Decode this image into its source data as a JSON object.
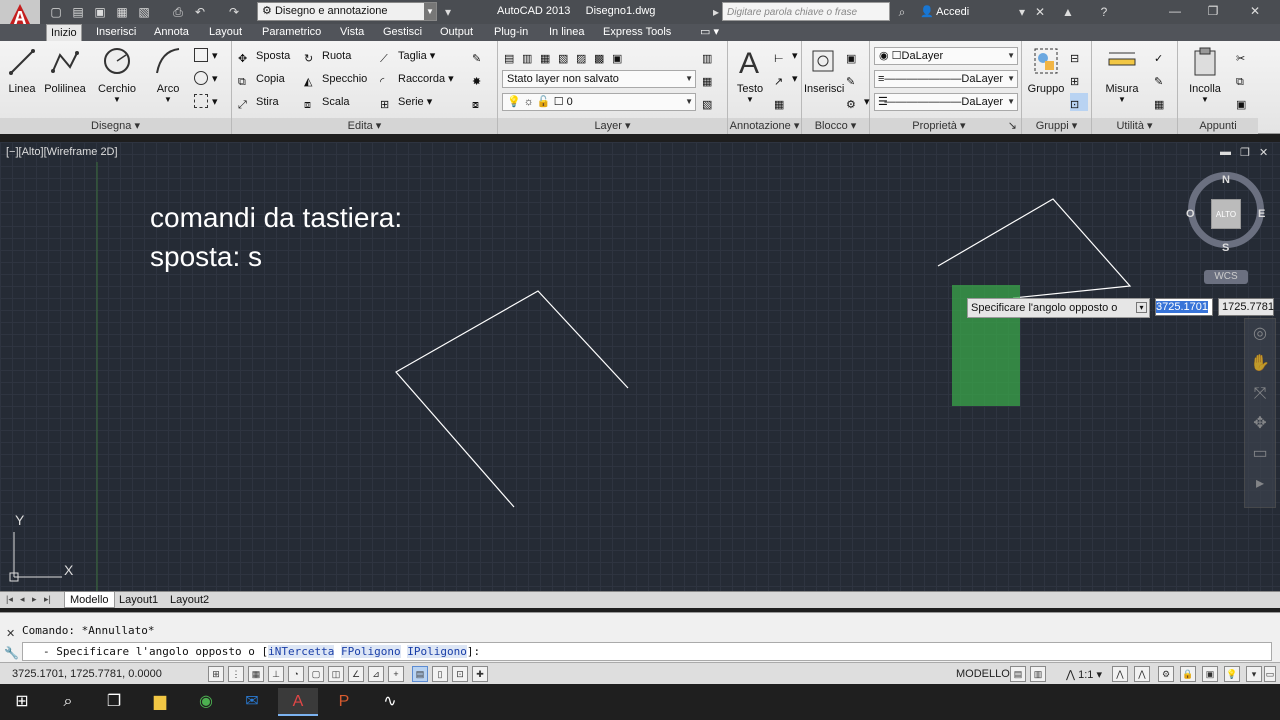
{
  "titlebar": {
    "workspace": "Disegno e annotazione",
    "app_title": "AutoCAD 2013",
    "file_name": "Disegno1.dwg",
    "search_placeholder": "Digitare parola chiave o frase",
    "signin_label": "Accedi"
  },
  "ribbon_tabs": [
    "Inizio",
    "Inserisci",
    "Annota",
    "Layout",
    "Parametrico",
    "Vista",
    "Gestisci",
    "Output",
    "Plug-in",
    "In linea",
    "Express Tools"
  ],
  "ribbon": {
    "disegna": {
      "title": "Disegna",
      "linea": "Linea",
      "polilinea": "Polilinea",
      "cerchio": "Cerchio",
      "arco": "Arco"
    },
    "edita": {
      "title": "Edita",
      "sposta": "Sposta",
      "ruota": "Ruota",
      "taglia": "Taglia",
      "copia": "Copia",
      "specchio": "Specchio",
      "raccorda": "Raccorda",
      "stira": "Stira",
      "scala": "Scala",
      "serie": "Serie"
    },
    "layer": {
      "title": "Layer",
      "state": "Stato layer non salvato",
      "current": "0"
    },
    "annotazione": {
      "title": "Annotazione",
      "testo": "Testo"
    },
    "blocco": {
      "title": "Blocco",
      "inserisci": "Inserisci"
    },
    "proprieta": {
      "title": "Proprietà",
      "color": "DaLayer",
      "linetype": "DaLayer",
      "lineweight": "DaLayer"
    },
    "gruppi": {
      "title": "Gruppi",
      "gruppo": "Gruppo"
    },
    "utilita": {
      "title": "Utilità",
      "misura": "Misura"
    },
    "appunti": {
      "title": "Appunti",
      "incolla": "Incolla"
    }
  },
  "drawing": {
    "viewport_label": "[−][Alto][Wireframe 2D]",
    "text_line1": "comandi da tastiera:",
    "text_line2": "sposta: s",
    "viewcube": {
      "north": "N",
      "south": "S",
      "east": "E",
      "west": "O",
      "face": "ALTO",
      "wcs": "WCS"
    },
    "ucs": {
      "y": "Y",
      "x": "X"
    },
    "dynamic_prompt": "Specificare l'angolo opposto o",
    "dynamic_x": "3725.1701",
    "dynamic_y": "1725.7781"
  },
  "layout_tabs": [
    "Modello",
    "Layout1",
    "Layout2"
  ],
  "command": {
    "history": "Comando: *Annullato*",
    "prompt_prefix": "- Specificare l'angolo opposto o [",
    "opt1": "iNTercetta",
    "opt2": "FPoligono",
    "opt3": "IPoligono",
    "prompt_suffix": "]:"
  },
  "statusbar": {
    "coords": "3725.1701, 1725.7781, 0.0000",
    "model": "MODELLO",
    "scale": "1:1"
  },
  "colors": {
    "selection_green": "#3aa64a",
    "canvas_bg": "#252b35",
    "ribbon_tab_bg": "#51545a"
  }
}
